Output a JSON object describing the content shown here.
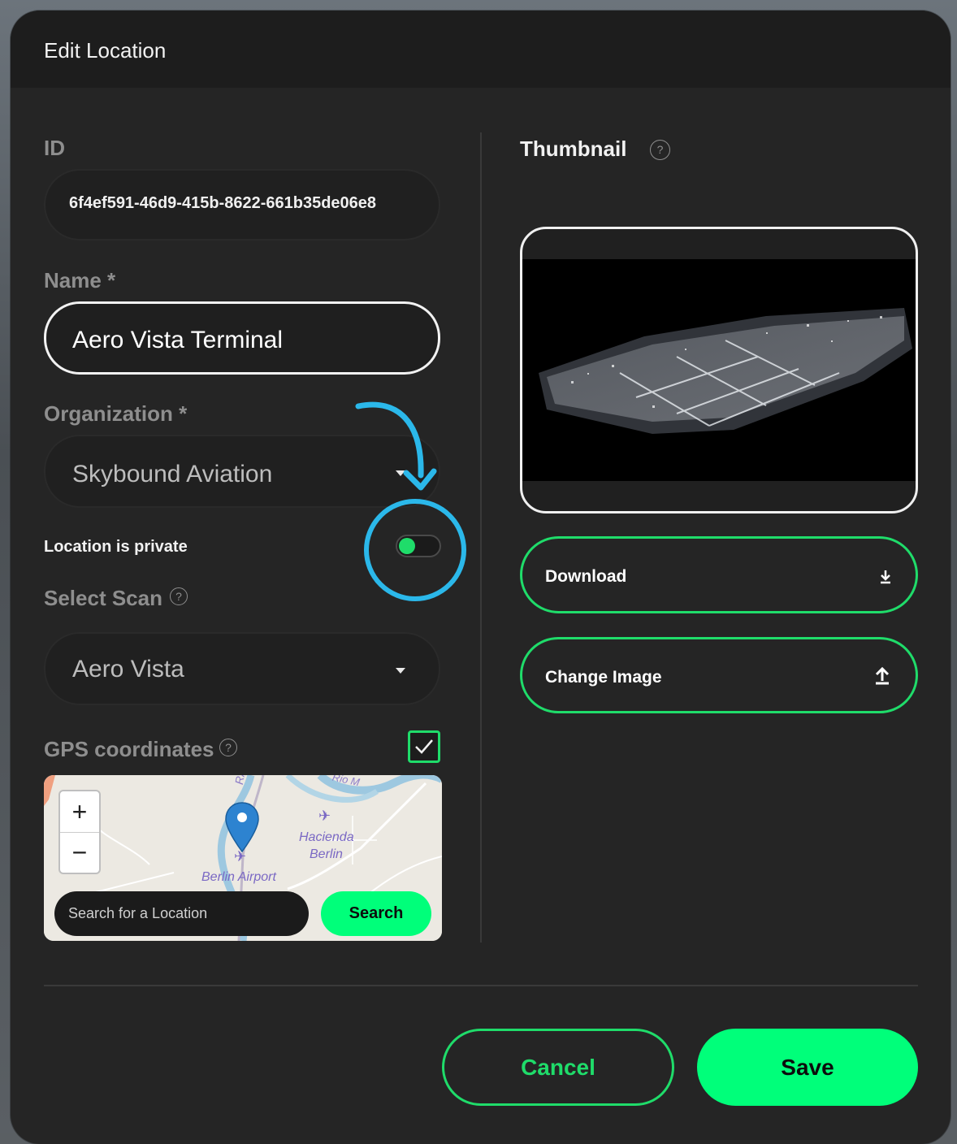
{
  "dialog": {
    "title": "Edit Location"
  },
  "id_field": {
    "label": "ID",
    "value": "6f4ef591-46d9-415b-8622-661b35de06e8"
  },
  "name_field": {
    "label": "Name *",
    "value": "Aero Vista Terminal"
  },
  "organization_field": {
    "label": "Organization *",
    "value": "Skybound Aviation"
  },
  "private_toggle": {
    "label": "Location is private",
    "on": true
  },
  "scan_field": {
    "label": "Select Scan",
    "value": "Aero Vista"
  },
  "gps": {
    "label": "GPS coordinates",
    "checked": true,
    "map": {
      "zoom_in": "+",
      "zoom_out": "−",
      "labels": [
        "Hacienda",
        "Berlin",
        "Berlin Airport",
        "RA",
        "Rio M"
      ],
      "search_placeholder": "Search for a Location",
      "search_button": "Search"
    }
  },
  "thumbnail": {
    "label": "Thumbnail"
  },
  "actions": {
    "download": "Download",
    "change_image": "Change Image",
    "cancel": "Cancel",
    "save": "Save"
  },
  "colors": {
    "accent_green": "#1fdc6a",
    "bright_green": "#00ff7a",
    "annotation_blue": "#2bb8ea",
    "panel_bg": "#252525"
  }
}
